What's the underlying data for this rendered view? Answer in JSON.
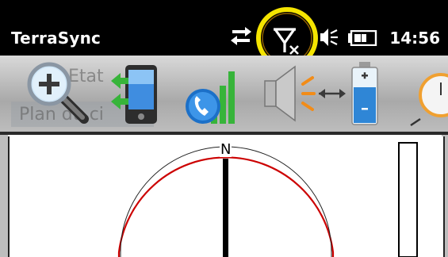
{
  "status_bar": {
    "app_title": "TerraSync",
    "clock": "14:56",
    "icons": [
      "sync-arrows-icon",
      "no-signal-antenna-icon",
      "speaker-off-icon",
      "battery-icon"
    ],
    "highlight_color": "#f5e400"
  },
  "toolbar": {
    "ghost_labels": [
      "Etat",
      "Plan du ci"
    ],
    "buttons": [
      "zoom-in-icon",
      "device-transfer-icon",
      "phone-signal-icon",
      "speaker-volume-icon",
      "battery-status-icon",
      "clock-icon"
    ]
  },
  "map": {
    "north_label": "N",
    "compass_color": "#cc0000"
  }
}
